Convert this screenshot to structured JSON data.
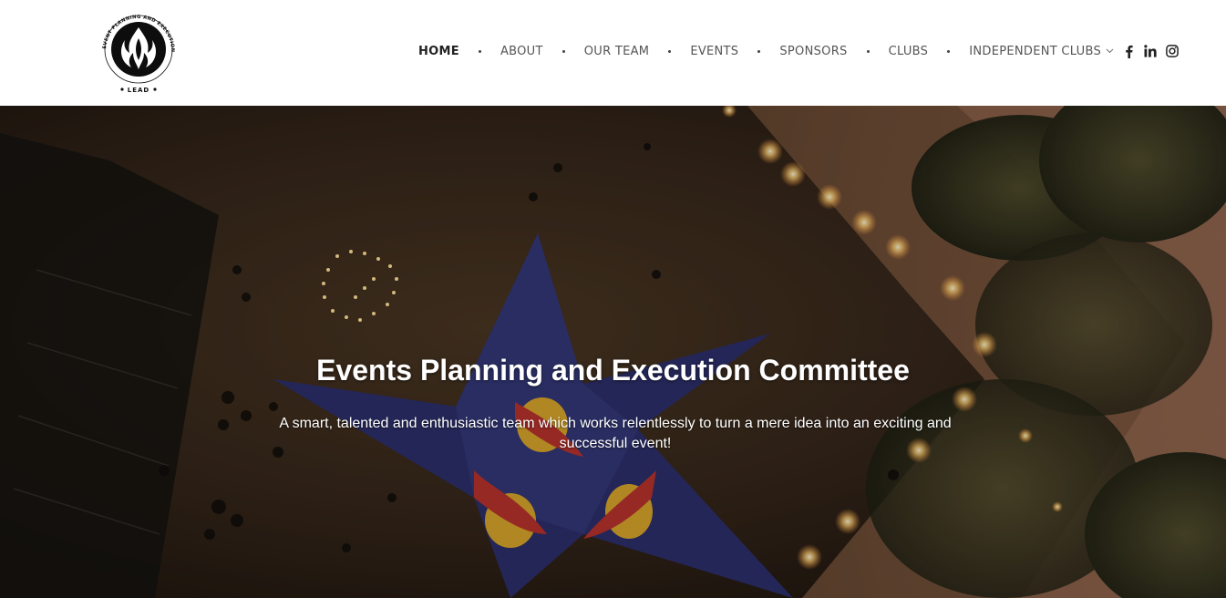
{
  "brand": {
    "logo_ring_text": "EVENT PLANNING AND EXECUTION COMMITTEE",
    "logo_bottom_text": "LEAD"
  },
  "nav": {
    "items": [
      {
        "label": "HOME",
        "active": true
      },
      {
        "label": "ABOUT",
        "active": false
      },
      {
        "label": "OUR TEAM",
        "active": false
      },
      {
        "label": "EVENTS",
        "active": false
      },
      {
        "label": "SPONSORS",
        "active": false
      },
      {
        "label": "CLUBS",
        "active": false
      },
      {
        "label": "INDEPENDENT CLUBS",
        "active": false,
        "has_dropdown": true
      }
    ],
    "social": [
      "facebook-icon",
      "linkedin-icon",
      "instagram-icon"
    ]
  },
  "hero": {
    "title": "Events Planning and Execution Committee",
    "subtitle": "A smart, talented and enthusiastic team which works relentlessly to turn a mere idea into an exciting and successful event!"
  },
  "colors": {
    "nav_text": "#555555",
    "nav_active": "#222222",
    "hero_text": "#ffffff",
    "tent": "#2c2f6b"
  }
}
